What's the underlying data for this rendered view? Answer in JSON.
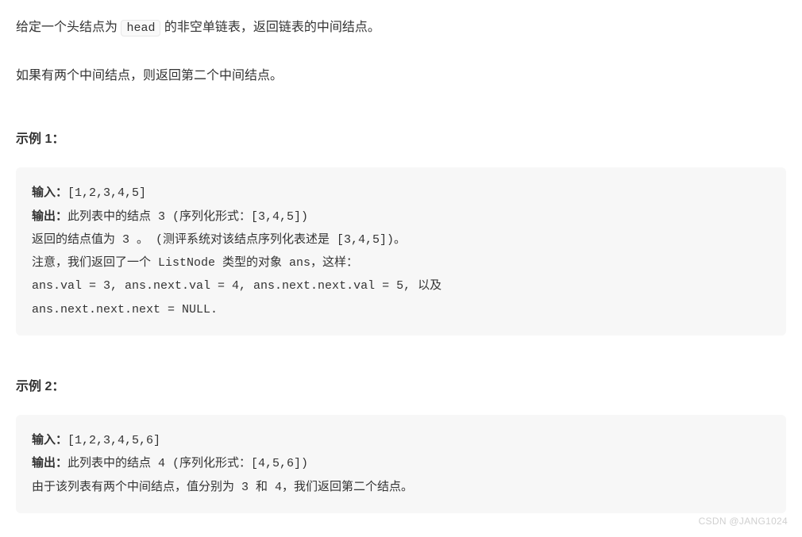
{
  "intro": {
    "part1": "给定一个头结点为 ",
    "code": "head",
    "part2": " 的非空单链表，返回链表的中间结点。",
    "line2": "如果有两个中间结点，则返回第二个中间结点。"
  },
  "example1": {
    "heading": "示例 1：",
    "input_label": "输入：",
    "input_value": "[1,2,3,4,5]",
    "output_label": "输出：",
    "output_value": "此列表中的结点 3 (序列化形式：[3,4,5])",
    "line3": "返回的结点值为 3 。 (测评系统对该结点序列化表述是 [3,4,5])。",
    "line4": "注意，我们返回了一个 ListNode 类型的对象 ans，这样：",
    "line5": "ans.val = 3, ans.next.val = 4, ans.next.next.val = 5, 以及",
    "line6": "ans.next.next.next = NULL."
  },
  "example2": {
    "heading": "示例 2：",
    "input_label": "输入：",
    "input_value": "[1,2,3,4,5,6]",
    "output_label": "输出：",
    "output_value": "此列表中的结点 4 (序列化形式：[4,5,6])",
    "line3": "由于该列表有两个中间结点，值分别为 3 和 4，我们返回第二个结点。"
  },
  "watermark": "CSDN @JANG1024"
}
